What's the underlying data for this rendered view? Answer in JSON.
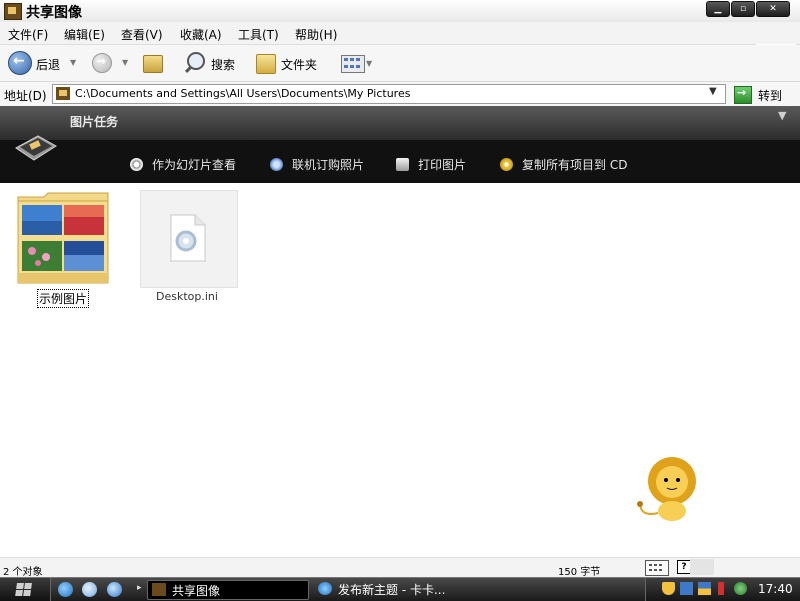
{
  "window": {
    "title": "共享图像"
  },
  "menu": {
    "file": "文件(F)",
    "edit": "编辑(E)",
    "view": "查看(V)",
    "favorites": "收藏(A)",
    "tools": "工具(T)",
    "help": "帮助(H)"
  },
  "toolbar": {
    "back": "后退",
    "search": "搜索",
    "folders": "文件夹"
  },
  "address": {
    "label": "地址(D)",
    "value": "C:\\Documents and Settings\\All Users\\Documents\\My Pictures",
    "go": "转到"
  },
  "taskpane": {
    "title": "图片任务",
    "tasks": [
      {
        "label": "作为幻灯片查看",
        "icon": "slideshow-icon"
      },
      {
        "label": "联机订购照片",
        "icon": "order-prints-icon"
      },
      {
        "label": "打印图片",
        "icon": "printer-icon"
      },
      {
        "label": "复制所有项目到 CD",
        "icon": "cd-burn-icon"
      }
    ]
  },
  "items": [
    {
      "label": "示例图片",
      "type": "folder"
    },
    {
      "label": "Desktop.ini",
      "type": "file"
    }
  ],
  "status": {
    "count": "2 个对象",
    "size": "150 字节"
  },
  "taskbar": {
    "tasks": [
      {
        "label": "共享图像",
        "active": true
      },
      {
        "label": "发布新主题 - 卡卡...",
        "active": false
      }
    ],
    "clock": "17:40"
  }
}
